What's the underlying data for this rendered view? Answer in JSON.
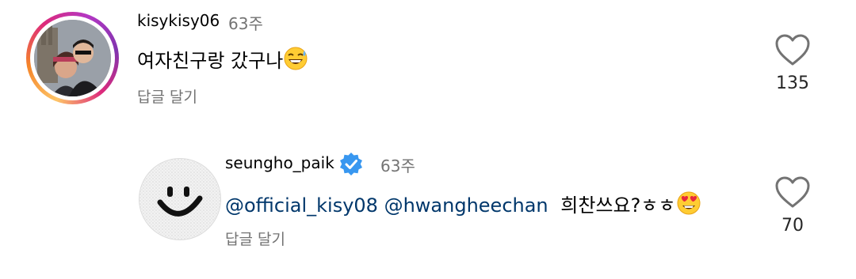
{
  "comments": [
    {
      "username": "kisykisy06",
      "time": "63주",
      "text": "여자친구랑 갔구나",
      "emoji_name": "grinning-sweat-emoji",
      "reply_label": "답글 달기",
      "like_count": "135"
    }
  ],
  "reply": {
    "username": "seungho_paik",
    "verified": true,
    "time": "63주",
    "mention1": "@official_kisy08",
    "mention2": "@hwangheechan",
    "text": "희찬쓰요?ㅎㅎ",
    "emoji_name": "heart-eyes-emoji",
    "reply_label": "답글 달기",
    "like_count": "70"
  },
  "colors": {
    "verified_badge": "#3897f0",
    "mention": "#00376b",
    "secondary_text": "#737373"
  }
}
